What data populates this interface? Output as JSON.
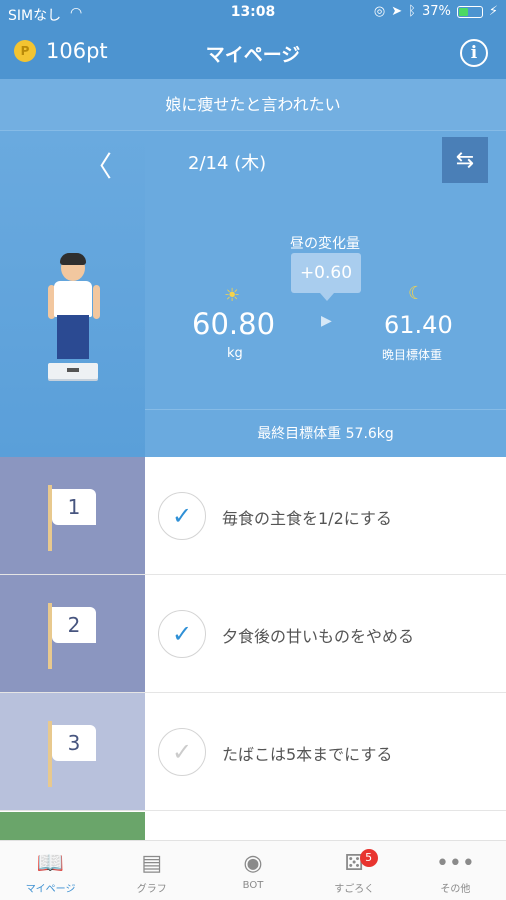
{
  "status_bar": {
    "carrier": "SIMなし",
    "time": "13:08",
    "battery": "37%",
    "battery_fraction": 0.37
  },
  "header": {
    "points": "106pt",
    "coin_symbol": "P",
    "title": "マイページ",
    "info_icon": "info-icon"
  },
  "goal": {
    "text": "娘に痩せたと言われたい"
  },
  "date_nav": {
    "prev_symbol": "〈",
    "date": "2/14 (木)",
    "swap_symbol": "⇆"
  },
  "weight": {
    "change_label": "昼の変化量",
    "change_value": "+0.60",
    "morning_value": "60.80",
    "morning_unit": "kg",
    "evening_value": "61.40",
    "evening_label": "晩目標体重",
    "final_target": "最終目標体重 57.6kg"
  },
  "tasks": [
    {
      "number": "1",
      "text": "毎食の主食を1/2にする",
      "checked": true,
      "color": "#8b96c0"
    },
    {
      "number": "2",
      "text": "夕食後の甘いものをやめる",
      "checked": true,
      "color": "#8b96c0"
    },
    {
      "number": "3",
      "text": "たばこは5本までにする",
      "checked": false,
      "color": "#b8c1dc"
    }
  ],
  "tabs": [
    {
      "label": "マイページ",
      "icon": "book-icon",
      "glyph": "📖",
      "active": true
    },
    {
      "label": "グラフ",
      "icon": "chart-icon",
      "glyph": "📊",
      "active": false
    },
    {
      "label": "BOT",
      "icon": "robot-icon",
      "glyph": "🤖",
      "active": false
    },
    {
      "label": "すごろく",
      "icon": "dice-icon",
      "glyph": "⚄",
      "active": false,
      "badge": "5"
    },
    {
      "label": "その他",
      "icon": "more-icon",
      "glyph": "•••",
      "active": false
    }
  ],
  "colors": {
    "header_blue": "#4d94d0",
    "panel_blue": "#6aaadf",
    "accent": "#3b8fd1",
    "check_active": "#2f90d6",
    "check_inactive": "#cccccc",
    "green_strip": "#6aa56a"
  }
}
